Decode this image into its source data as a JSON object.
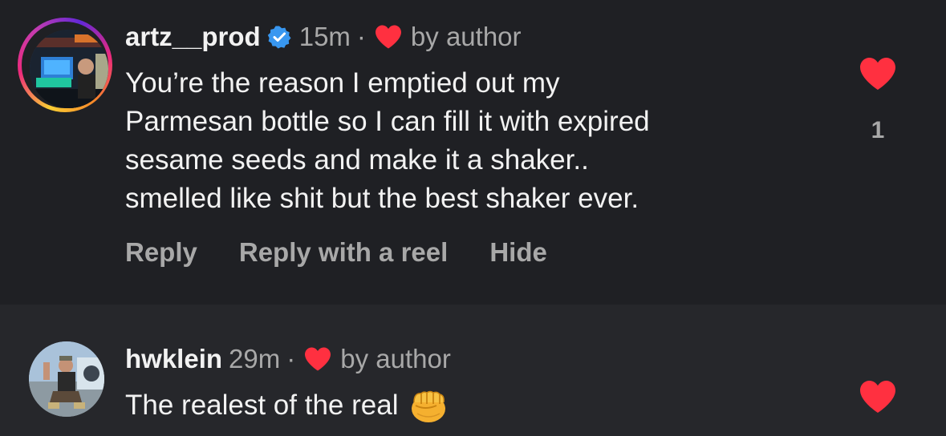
{
  "comments": [
    {
      "username": "artz__prod",
      "verified": true,
      "time": "15m",
      "separator": "·",
      "by_author_label": "by author",
      "text_lines": [
        "You’re the reason I emptied out my",
        "Parmesan bottle so I can fill it with expired",
        "sesame seeds and make it a shaker..",
        "smelled like shit but the best shaker ever."
      ],
      "like_count": "1",
      "actions": [
        "Reply",
        "Reply with a reel",
        "Hide"
      ],
      "icons": {
        "verified": "verified-badge-icon",
        "author_like": "heart-icon",
        "like": "heart-icon"
      }
    },
    {
      "username": "hwklein",
      "time": "29m",
      "separator": "·",
      "by_author_label": "by author",
      "text": "The realest of the real",
      "emoji": "fist-emoji",
      "icons": {
        "author_like": "heart-icon",
        "like": "heart-icon"
      }
    }
  ],
  "colors": {
    "background_highlight": "#1f2024",
    "background": "#26272b",
    "text_primary": "#f2f2f2",
    "text_secondary": "#a8a8a8",
    "heart_red": "#ff3040",
    "verified_blue": "#3897f0"
  }
}
